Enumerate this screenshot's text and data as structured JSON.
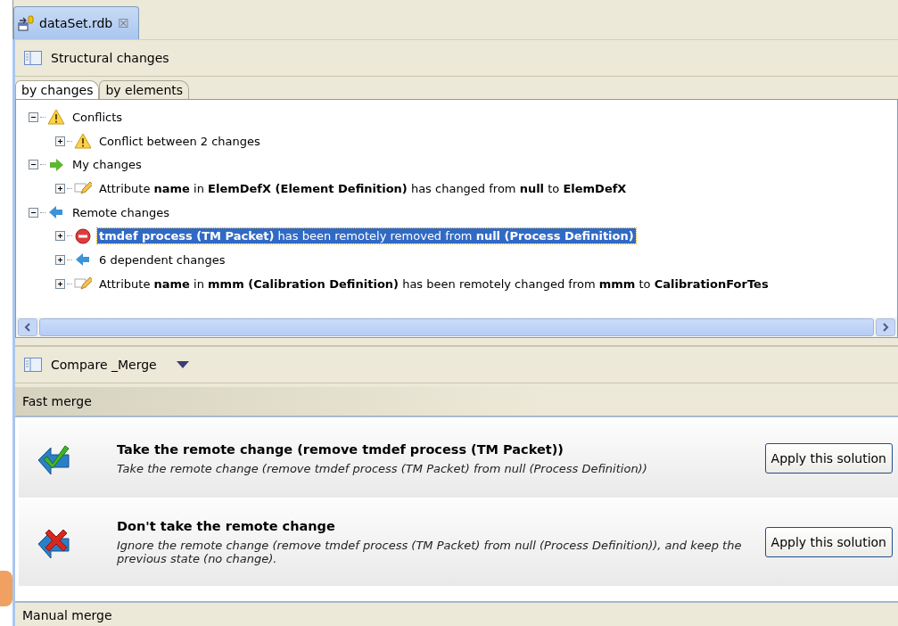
{
  "editor_tab": {
    "title": "dataSet.rdb",
    "close": "☒"
  },
  "structural_panel": {
    "title": "Structural changes",
    "tabs": [
      {
        "label": "by changes",
        "selected": true
      },
      {
        "label": "by elements",
        "selected": false
      }
    ],
    "tree": [
      {
        "kind": "warning",
        "label": "Conflicts",
        "expanded": true,
        "selected": false,
        "children": [
          {
            "kind": "warning",
            "label": "Conflict between 2 changes",
            "expanded": false,
            "selected": false
          }
        ]
      },
      {
        "kind": "mine",
        "label": "My changes",
        "expanded": true,
        "selected": false,
        "children": [
          {
            "kind": "edit",
            "label": "Attribute **name** in **ElemDefX (Element Definition)** has changed from **null** to **ElemDefX**",
            "expanded": false,
            "selected": false
          }
        ]
      },
      {
        "kind": "remote",
        "label": "Remote changes",
        "expanded": true,
        "selected": false,
        "children": [
          {
            "kind": "removed",
            "label": "**tmdef process (TM Packet)** has been remotely removed from **null (Process Definition)**",
            "expanded": false,
            "selected": true
          },
          {
            "kind": "remote",
            "label": "6 dependent changes",
            "expanded": false,
            "selected": false
          },
          {
            "kind": "edit",
            "label": "Attribute **name** in **mmm (Calibration Definition)** has been remotely changed from **mmm** to **CalibrationForTes**",
            "expanded": false,
            "selected": false
          }
        ]
      }
    ]
  },
  "merge_panel": {
    "title": "Compare _Merge",
    "fast_merge": {
      "title": "Fast merge",
      "solutions": [
        {
          "kind": "accept",
          "title": "Take the remote change (remove tmdef process (TM Packet))",
          "description": "Take the remote change (remove tmdef process (TM Packet) from null (Process Definition))",
          "button": "Apply this solution"
        },
        {
          "kind": "reject",
          "title": "Don't take the remote change",
          "description": "Ignore the remote change (remove tmdef process (TM Packet) from null (Process Definition)), and keep the previous state (no change).",
          "button": "Apply this solution"
        }
      ]
    },
    "manual_merge": {
      "title": "Manual merge"
    }
  }
}
